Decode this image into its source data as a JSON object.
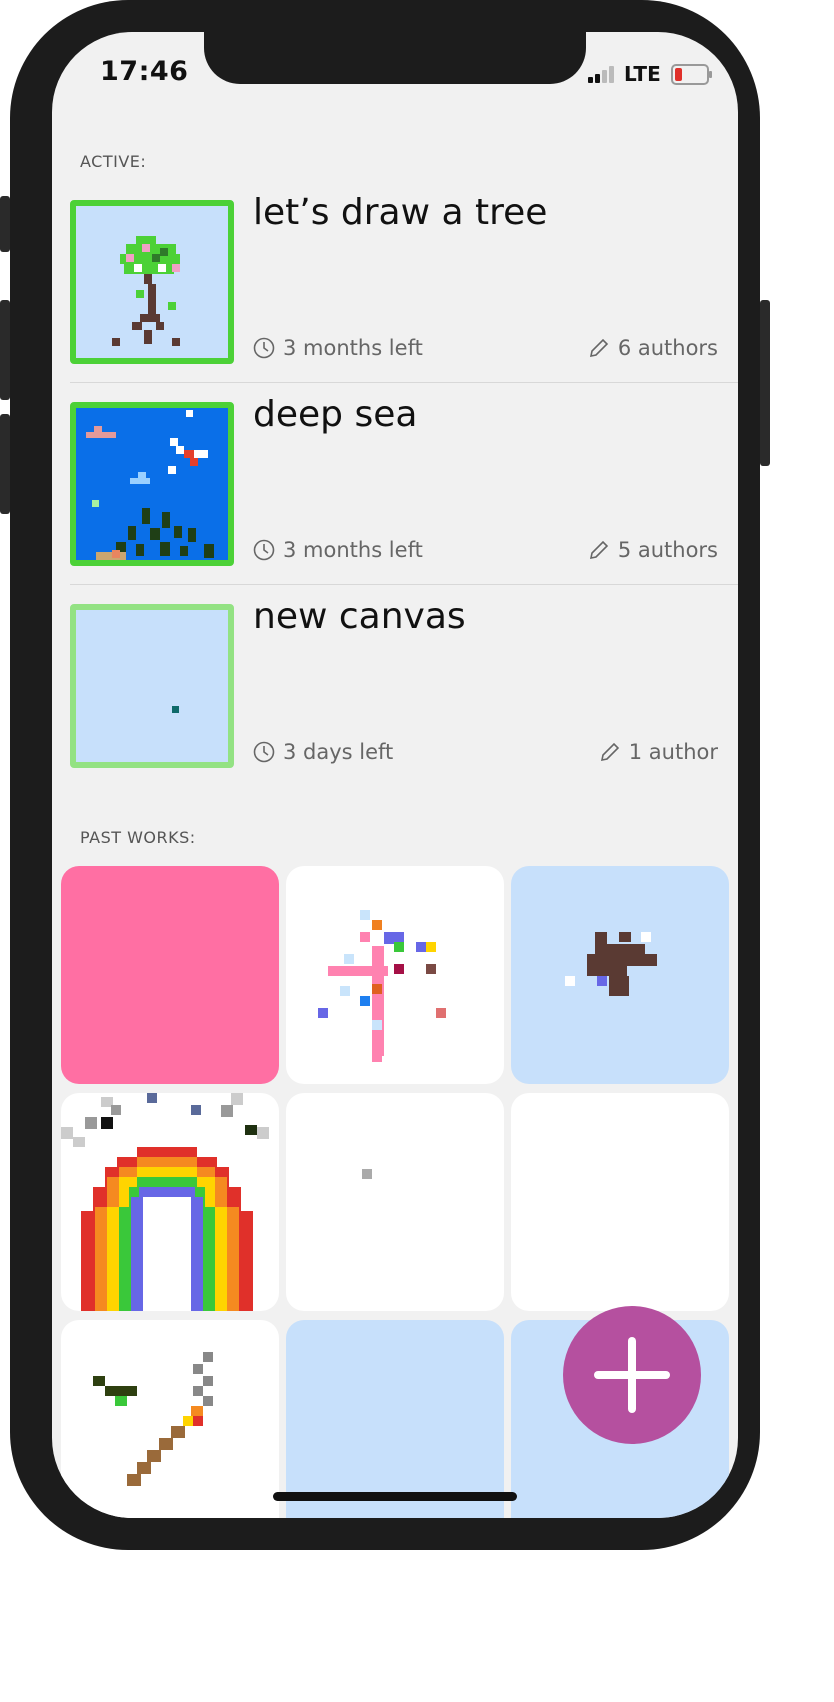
{
  "status_bar": {
    "time": "17:46",
    "network": "LTE"
  },
  "sections": {
    "active_label": "ACTIVE:",
    "past_label": "PAST WORKS:"
  },
  "active": [
    {
      "title": "let’s draw a tree",
      "time_left": "3 months left",
      "authors": "6 authors"
    },
    {
      "title": "deep sea",
      "time_left": "3 months left",
      "authors": "5 authors"
    },
    {
      "title": "new canvas",
      "time_left": "3 days left",
      "authors": "1 author"
    }
  ],
  "icons": {
    "clock": "clock-icon",
    "pencil": "pencil-icon",
    "add": "plus-icon"
  },
  "colors": {
    "active_border": "#4cd137",
    "fab": "#b5509f",
    "canvas_blue": "#c7e0fb",
    "pink_tile": "#ff6fa3"
  }
}
